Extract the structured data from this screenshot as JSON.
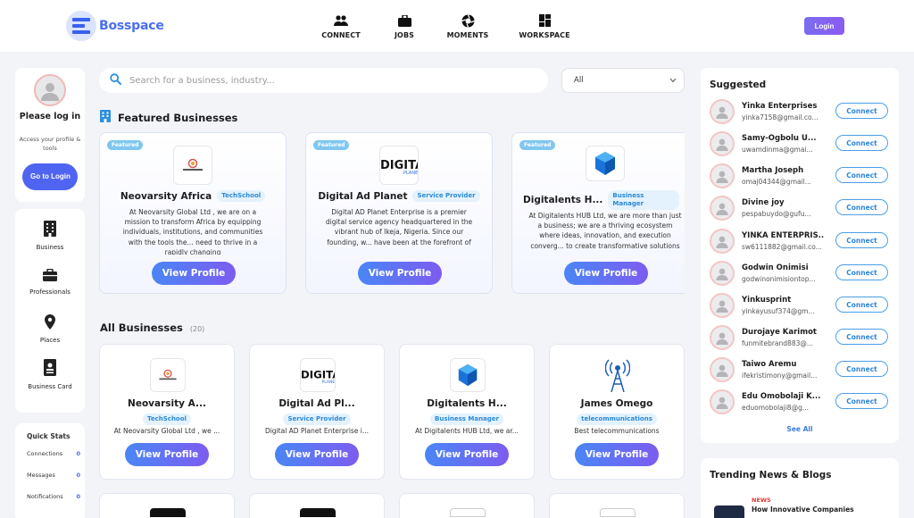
{
  "header": {
    "brand": "Bosspace",
    "nav": [
      {
        "label": "CONNECT",
        "icon": "users-icon"
      },
      {
        "label": "JOBS",
        "icon": "briefcase-icon"
      },
      {
        "label": "MOMENTS",
        "icon": "aperture-icon"
      },
      {
        "label": "WORKSPACE",
        "icon": "grid-icon"
      }
    ],
    "login_label": "Login"
  },
  "sidebar": {
    "login_card": {
      "title": "Please log in",
      "subtitle": "Access your profile & tools",
      "button": "Go to Login"
    },
    "menu": [
      {
        "label": "Business",
        "icon": "building-icon"
      },
      {
        "label": "Professionals",
        "icon": "briefcase-icon"
      },
      {
        "label": "Places",
        "icon": "map-pin-icon"
      },
      {
        "label": "Business Card",
        "icon": "id-card-icon"
      }
    ],
    "stats": {
      "title": "Quick Stats",
      "rows": [
        {
          "label": "Connections",
          "value": "0"
        },
        {
          "label": "Messages",
          "value": "0"
        },
        {
          "label": "Notifications",
          "value": "0"
        }
      ]
    }
  },
  "search": {
    "placeholder": "Search for a business, industry...",
    "filter_value": "All"
  },
  "featured": {
    "title": "Featured Businesses",
    "badge": "Featured",
    "items": [
      {
        "name": "Neovarsity Africa",
        "category": "TechSchool",
        "description": "At Neovarsity Global Ltd , we are on a mission to transform Africa by equipping individuals, institutions, and communities with the tools the... need to thrive in a rapidly changing",
        "button": "View Profile"
      },
      {
        "name": "Digital Ad Planet",
        "category": "Service Provider",
        "description": "Digital AD Planet Enterprise is a premier digital service agency headquartered in the vibrant hub of Ikeja, Nigeria. Since our founding, w... have been at the forefront of",
        "button": "View Profile"
      },
      {
        "name": "Digitalents H...",
        "category": "Business Manager",
        "description": "At Digitalents HUB Ltd, we are more than just a business; we are a thriving ecosystem where ideas, innovation, and execution converg... to create transformative solutions",
        "button": "View Profile"
      }
    ]
  },
  "all_businesses": {
    "title": "All Businesses",
    "count": "(20)",
    "items": [
      {
        "name": "Neovarsity A...",
        "category": "TechSchool",
        "description": "At Neovarsity Global Ltd , we ...",
        "button": "View Profile"
      },
      {
        "name": "Digital Ad Pl...",
        "category": "Service Provider",
        "description": "Digital AD Planet Enterprise i...",
        "button": "View Profile"
      },
      {
        "name": "Digitalents H...",
        "category": "Business Manager",
        "description": "At Digitalents HUB Ltd, we ar...",
        "button": "View Profile"
      },
      {
        "name": "James Omego",
        "category": "telecommunications",
        "description": "Best telecommunications",
        "button": "View Profile"
      }
    ]
  },
  "suggested": {
    "title": "Suggested",
    "connect_label": "Connect",
    "see_all": "See All",
    "people": [
      {
        "name": "Yinka Enterprises",
        "email": "yinka7158@gmail.co..."
      },
      {
        "name": "Samy-Ogbolu U...",
        "email": "uwamdinma@gmai..."
      },
      {
        "name": "Martha Joseph",
        "email": "omaj04344@gmail..."
      },
      {
        "name": "Divine joy",
        "email": "pespabuydo@gufu..."
      },
      {
        "name": "YINKA ENTERPRIS...",
        "email": "sw6111882@gmail.co..."
      },
      {
        "name": "Godwin Onimisi",
        "email": "godwinonimisiontop..."
      },
      {
        "name": "Yinkusprint",
        "email": "yinkayusuf374@gm..."
      },
      {
        "name": "Durojaye Karimot",
        "email": "funmitebrand883@..."
      },
      {
        "name": "Taiwo Aremu",
        "email": "ifekristimony@gmail..."
      },
      {
        "name": "Edu Omobolaji K...",
        "email": "eduomobolaji8@g..."
      }
    ]
  },
  "news": {
    "title": "Trending News & Blogs",
    "tag": "NEWS",
    "headline": "How Innovative Companies"
  },
  "colors": {
    "accent": "#4f64f0",
    "brand": "#4b6ff2",
    "link": "#2f86d8"
  }
}
